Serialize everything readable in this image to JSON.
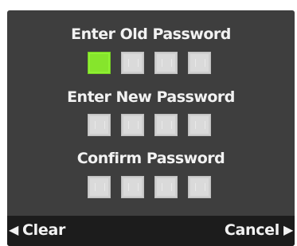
{
  "sections": [
    {
      "title": "Enter Old Password"
    },
    {
      "title": "Enter New Password"
    },
    {
      "title": "Confirm Password"
    }
  ],
  "softkeys": {
    "clear": "Clear",
    "cancel": "Cancel",
    "left_icon": "triangle-left-icon",
    "right_icon": "triangle-right-icon"
  },
  "colors": {
    "screen_bg": "#3e3e3e",
    "active_digit": "#86e52c",
    "empty_digit": "#dadada",
    "softbar_bg": "#1c1c1c"
  }
}
